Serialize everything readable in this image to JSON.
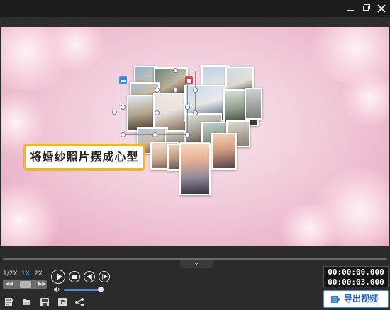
{
  "window": {
    "controls": [
      "minimize-icon",
      "restore-icon",
      "close-icon"
    ]
  },
  "preview": {
    "caption_text": "将婚纱照片摆成心型",
    "photo_count": 20
  },
  "playback": {
    "speeds": [
      "1/2X",
      "1X",
      "2X"
    ],
    "active_speed": "1X",
    "current_time": "00:00:00.000",
    "total_time": "00:00:03.000",
    "progress": 0.0,
    "volume": 1.0
  },
  "toolbar": {
    "icons": [
      "edit-icon",
      "folder-open-icon",
      "save-icon",
      "save-as-icon",
      "share-icon"
    ],
    "export_label": "导出视频"
  },
  "colors": {
    "accent": "#3aa3ff",
    "caption_border": "#f6b51c",
    "preview_bg": "#f2ccdb"
  }
}
